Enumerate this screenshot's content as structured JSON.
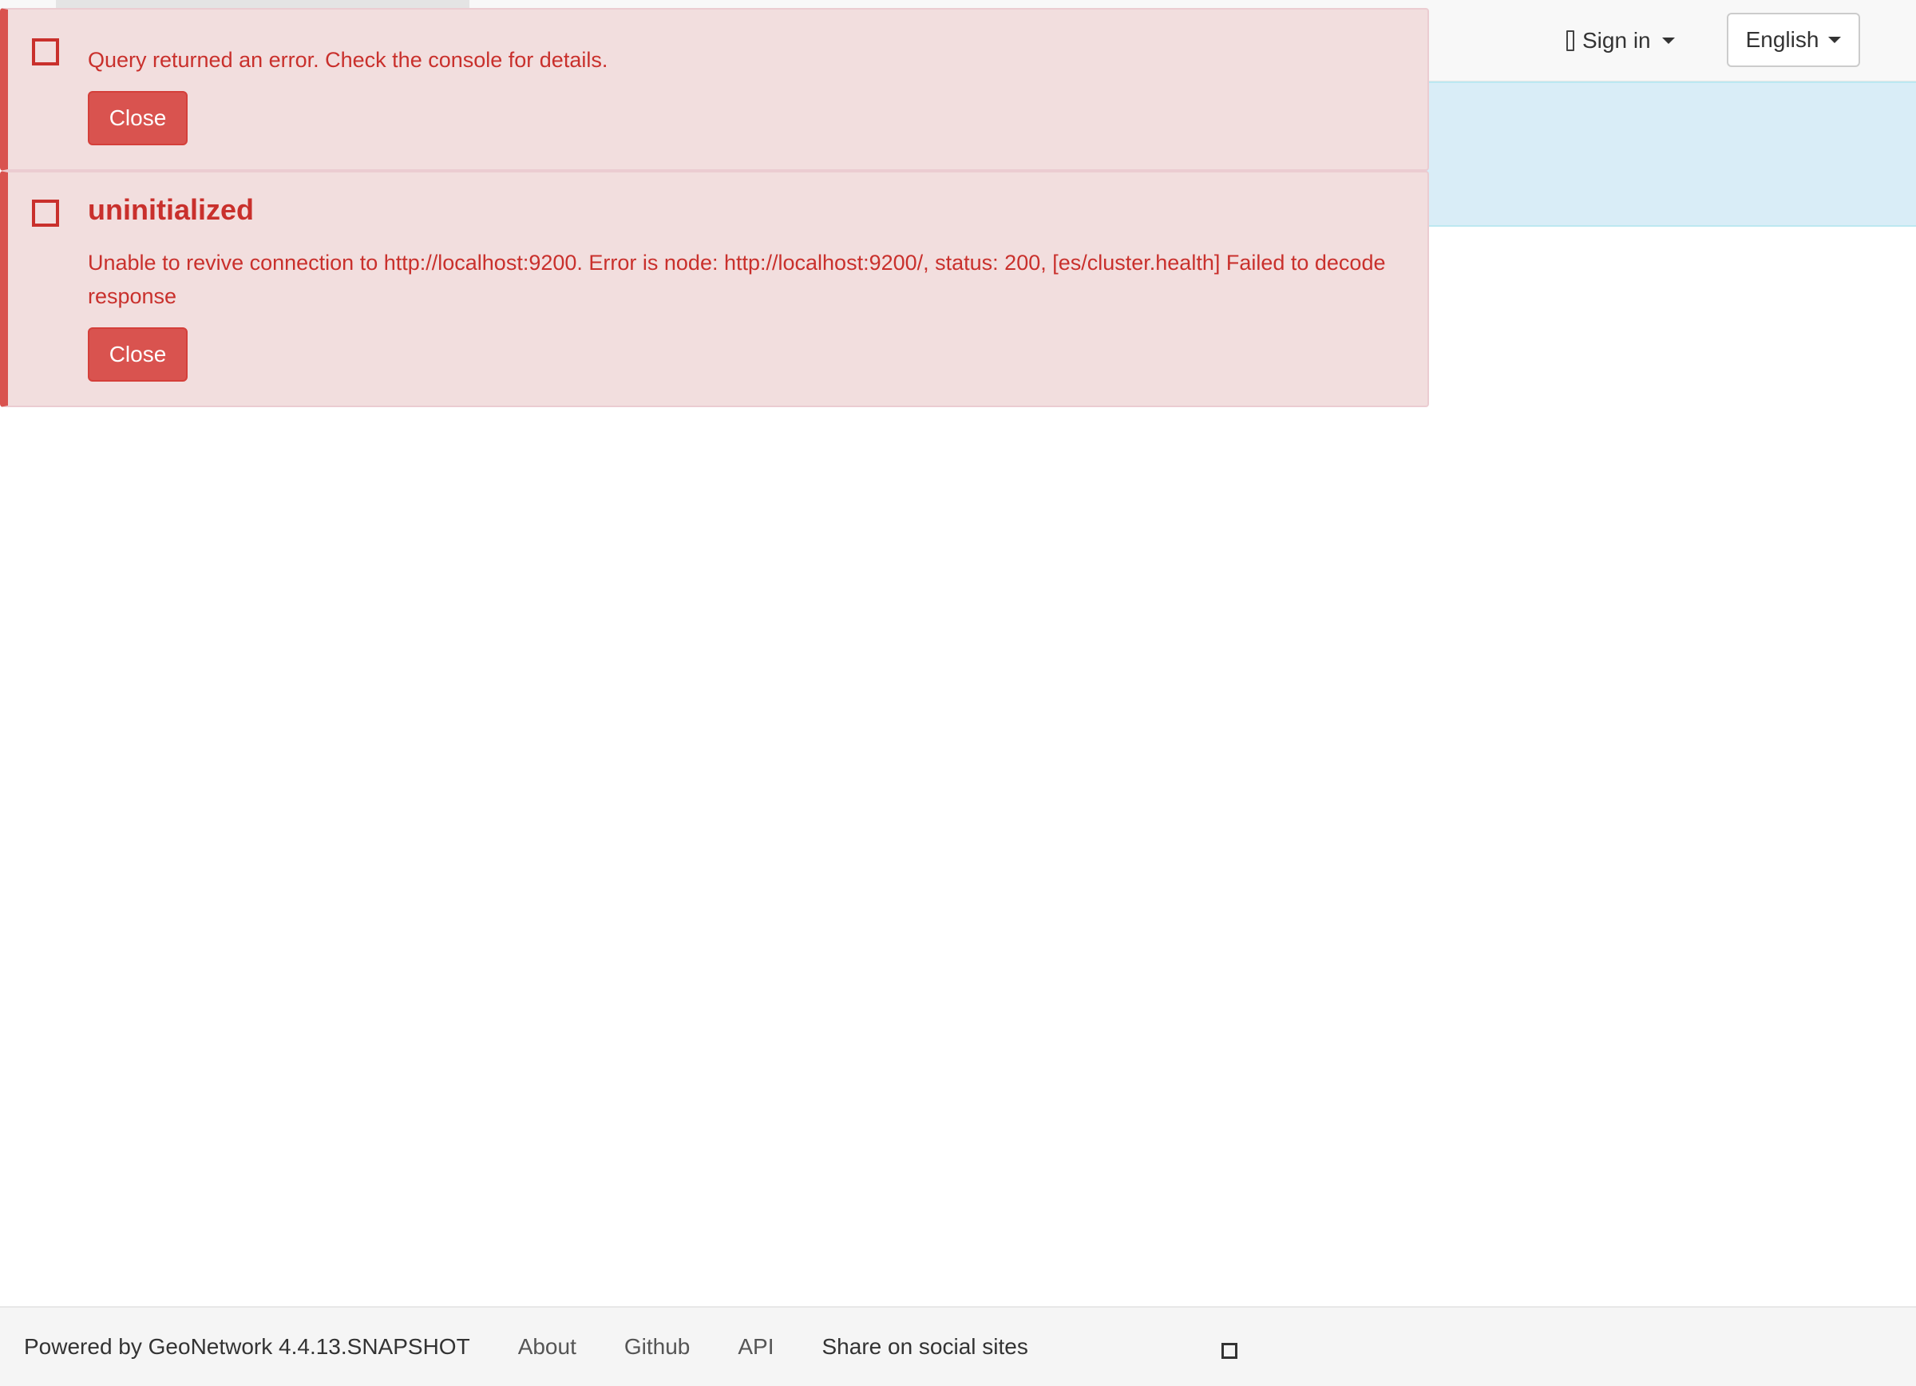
{
  "navbar": {
    "signin_label": "Sign in",
    "user_icon": "user-icon",
    "language_label": "English"
  },
  "alerts": [
    {
      "icon": "warning-icon",
      "title": "",
      "message": "Query returned an error. Check the console for details.",
      "close_label": "Close"
    },
    {
      "icon": "warning-icon",
      "title": "uninitialized",
      "message": "Unable to revive connection to http://localhost:9200. Error is node: http://localhost:9200/, status: 200, [es/cluster.health] Failed to decode response",
      "close_label": "Close"
    }
  ],
  "footer": {
    "powered_by": "Powered by GeoNetwork 4.4.13.SNAPSHOT",
    "links": [
      "About",
      "Github",
      "API"
    ],
    "share_label": "Share on social sites",
    "share_icon": "share-icon"
  },
  "colors": {
    "alert_bg": "#f2dede",
    "alert_accent": "#d9534f",
    "alert_text": "#c9302c",
    "info_bg": "#d9edf7",
    "navbar_bg": "#f8f8f8",
    "footer_bg": "#f5f5f5"
  }
}
